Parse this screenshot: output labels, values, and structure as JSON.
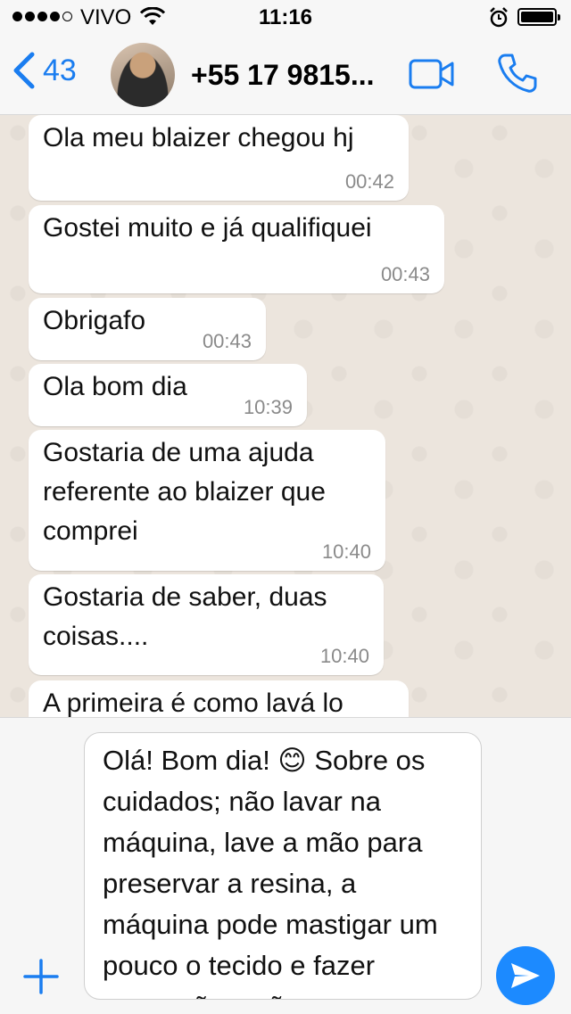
{
  "status_bar": {
    "carrier": "VIVO",
    "time": "11:16"
  },
  "header": {
    "back_count": "43",
    "contact_name": "+55 17 9815..."
  },
  "messages": [
    {
      "text": "Ola meu blaizer chegou hj",
      "time": "00:42"
    },
    {
      "text": "Gostei muito e já qualifiquei",
      "time": "00:43"
    },
    {
      "text": "Obrigafo",
      "time": "00:43"
    },
    {
      "text": "Ola bom dia",
      "time": "10:39"
    },
    {
      "text": "Gostaria de uma ajuda referente ao blaizer que comprei",
      "time": "10:40"
    },
    {
      "text": "Gostaria de saber, duas coisas....",
      "time": "10:40"
    },
    {
      "text": "A primeira é como lavá lo",
      "time": ""
    }
  ],
  "composer": {
    "text": "Olá! Bom dia! 😊  Sobre os cuidados; não lavar na máquina, lave a mão para preservar a resina, a máquina pode mastigar um pouco o tecido e fazer marcações, não passar o"
  },
  "colors": {
    "accent": "#1a7df0",
    "send_button": "#1c8aff",
    "chat_background": "#ece5dd",
    "bubble": "#ffffff"
  },
  "icons": [
    "signal-dots-icon",
    "wifi-icon",
    "alarm-icon",
    "battery-icon",
    "back-chevron-icon",
    "video-call-icon",
    "phone-icon",
    "plus-icon",
    "send-icon"
  ]
}
